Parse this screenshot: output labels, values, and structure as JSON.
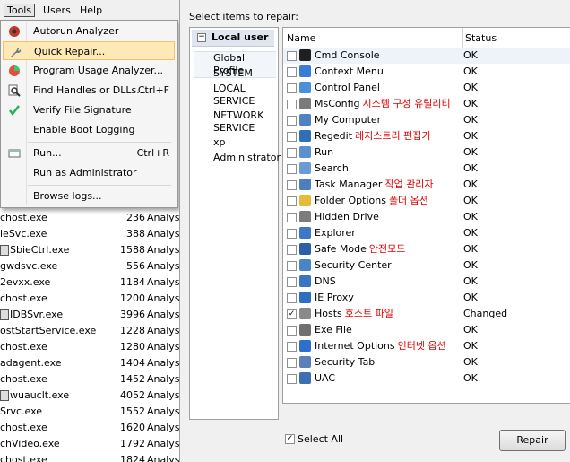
{
  "menubar": {
    "tools": "Tools",
    "users": "Users",
    "help": "Help"
  },
  "tools_menu": {
    "autorun": "Autorun Analyzer",
    "quick_repair": "Quick Repair...",
    "program_usage": "Program Usage Analyzer...",
    "find_handles": "Find Handles or DLLs...",
    "find_handles_shortcut": "Ctrl+F",
    "verify_signature": "Verify File Signature",
    "boot_logging": "Enable Boot Logging",
    "run": "Run...",
    "run_shortcut": "Ctrl+R",
    "run_admin": "Run as Administrator",
    "browse_logs": "Browse logs..."
  },
  "processes": [
    {
      "name": "chost.exe",
      "pid": "236",
      "status": "Analysi"
    },
    {
      "name": "ieSvc.exe",
      "pid": "388",
      "status": "Analysi"
    },
    {
      "name": "SbieCtrl.exe",
      "pid": "1588",
      "status": "Analysi",
      "icon": true
    },
    {
      "name": "gwdsvc.exe",
      "pid": "556",
      "status": "Analysi"
    },
    {
      "name": "2evxx.exe",
      "pid": "1184",
      "status": "Analysi"
    },
    {
      "name": "chost.exe",
      "pid": "1200",
      "status": "Analysi"
    },
    {
      "name": "IDBSvr.exe",
      "pid": "3996",
      "status": "Analysi",
      "icon": true
    },
    {
      "name": "ostStartService.exe",
      "pid": "1228",
      "status": "Analysi"
    },
    {
      "name": "chost.exe",
      "pid": "1280",
      "status": "Analysi"
    },
    {
      "name": "adagent.exe",
      "pid": "1404",
      "status": "Analysi"
    },
    {
      "name": "chost.exe",
      "pid": "1452",
      "status": "Analysi"
    },
    {
      "name": "wuauclt.exe",
      "pid": "4052",
      "status": "Analysi",
      "icon": true
    },
    {
      "name": "Srvc.exe",
      "pid": "1552",
      "status": "Analysi"
    },
    {
      "name": "chost.exe",
      "pid": "1620",
      "status": "Analysi"
    },
    {
      "name": "chVideo.exe",
      "pid": "1792",
      "status": "Analysi"
    },
    {
      "name": "chost.exe",
      "pid": "1824",
      "status": "Analysi"
    }
  ],
  "dialog": {
    "title": "Select items to repair:",
    "user_header": "Local user",
    "users": [
      "Global Profile",
      "SYSTEM",
      "LOCAL SERVICE",
      "NETWORK SERVICE",
      "xp",
      "Administrator"
    ],
    "col_name": "Name",
    "col_status": "Status",
    "items": [
      {
        "name": "Cmd Console",
        "kor": "",
        "status": "OK",
        "checked": false
      },
      {
        "name": "Context Menu",
        "kor": "",
        "status": "OK",
        "checked": false
      },
      {
        "name": "Control Panel",
        "kor": "",
        "status": "OK",
        "checked": false
      },
      {
        "name": "MsConfig",
        "kor": "시스템 구성 유틸리티",
        "status": "OK",
        "checked": false
      },
      {
        "name": "My Computer",
        "kor": "",
        "status": "OK",
        "checked": false
      },
      {
        "name": "Regedit",
        "kor": "레지스트리 편집기",
        "status": "OK",
        "checked": false
      },
      {
        "name": "Run",
        "kor": "",
        "status": "OK",
        "checked": false
      },
      {
        "name": "Search",
        "kor": "",
        "status": "OK",
        "checked": false
      },
      {
        "name": "Task Manager",
        "kor": "작업 관리자",
        "status": "OK",
        "checked": false
      },
      {
        "name": "Folder Options",
        "kor": "폴더 옵션",
        "status": "OK",
        "checked": false
      },
      {
        "name": "Hidden Drive",
        "kor": "",
        "status": "OK",
        "checked": false
      },
      {
        "name": "Explorer",
        "kor": "",
        "status": "OK",
        "checked": false
      },
      {
        "name": "Safe Mode",
        "kor": "안전모드",
        "status": "OK",
        "checked": false
      },
      {
        "name": "Security Center",
        "kor": "",
        "status": "OK",
        "checked": false
      },
      {
        "name": "DNS",
        "kor": "",
        "status": "OK",
        "checked": false
      },
      {
        "name": "IE Proxy",
        "kor": "",
        "status": "OK",
        "checked": false
      },
      {
        "name": "Hosts",
        "kor": "호스트 파일",
        "status": "Changed",
        "checked": true
      },
      {
        "name": "Exe File",
        "kor": "",
        "status": "OK",
        "checked": false
      },
      {
        "name": "Internet Options",
        "kor": "인터넷 옵션",
        "status": "OK",
        "checked": false
      },
      {
        "name": "Security Tab",
        "kor": "",
        "status": "OK",
        "checked": false
      },
      {
        "name": "UAC",
        "kor": "",
        "status": "OK",
        "checked": false
      }
    ],
    "select_all": "Select All",
    "repair": "Repair"
  },
  "icon_colors": [
    "#1f1f1f",
    "#3a7bd5",
    "#4a90d9",
    "#7a7a7a",
    "#4f82c4",
    "#2e6fb8",
    "#5a8fd0",
    "#6b9bd6",
    "#4d7fbf",
    "#e8b93a",
    "#7c7c7c",
    "#3f77c8",
    "#2d5fa8",
    "#4a86c7",
    "#3b74c2",
    "#2f6fc2",
    "#8a8a8a",
    "#6f6f6f",
    "#2c6fcf",
    "#5b7fb8",
    "#3d6fb3"
  ]
}
